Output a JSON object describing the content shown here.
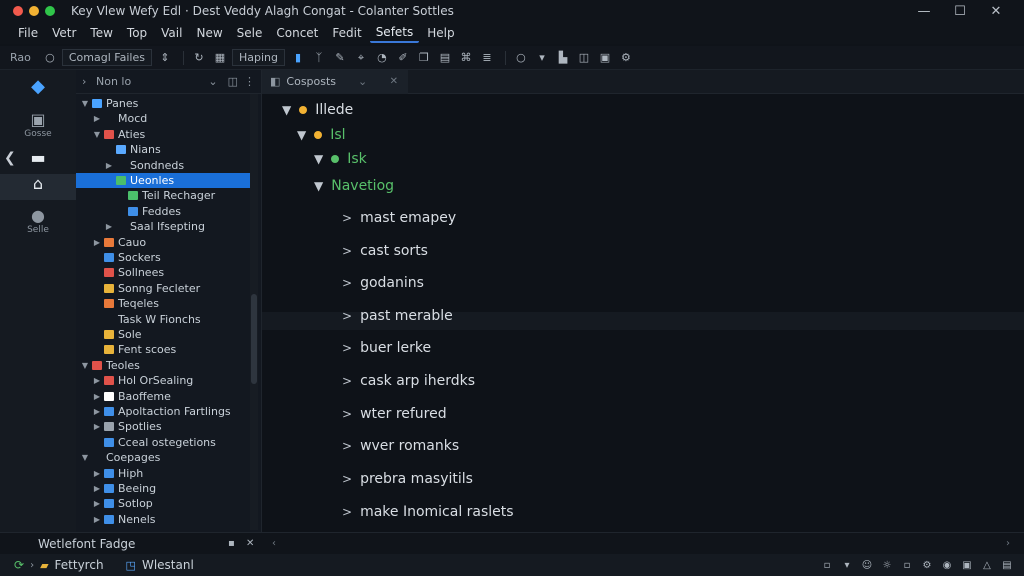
{
  "titlebar": {
    "title": "Key  Vlew  Wefy  Edl  ·  Dest  Veddy  Alagh  Congat  -  Colanter Sottles",
    "light_colors": [
      "#f25a4d",
      "#f2b233",
      "#30c54a"
    ],
    "minimize": "—",
    "maximize": "☐",
    "close": "✕"
  },
  "menubar": {
    "items": [
      "File",
      "Vetr",
      "Tew",
      "Top",
      "Vail",
      "New",
      "Sele",
      "Concet",
      "Fedit",
      "Sefets",
      "Help"
    ],
    "active_index": 9
  },
  "toolbar": {
    "left_text": "Rao",
    "combo1": "Comagl Failes",
    "combo2": "Haping"
  },
  "activity": {
    "items": [
      {
        "icon": "blocks-icon",
        "label": ""
      },
      {
        "icon": "book-icon",
        "label": "Gosse"
      },
      {
        "icon": "monitor-icon",
        "label": ""
      },
      {
        "icon": "home-icon",
        "label": ""
      },
      {
        "icon": "user-icon",
        "label": "Selle"
      }
    ]
  },
  "explorer": {
    "header": "Non lo",
    "rows": [
      {
        "label": "Panes",
        "depth": 0,
        "twisty": "▼",
        "icon": "#4aa3ff"
      },
      {
        "label": "Mocd",
        "depth": 1,
        "twisty": "▶",
        "icon": ""
      },
      {
        "label": "Aties",
        "depth": 1,
        "twisty": "▼",
        "icon": "#e0524a"
      },
      {
        "label": "Nians",
        "depth": 2,
        "twisty": "",
        "icon": "#5aa9ff"
      },
      {
        "label": "Sondneds",
        "depth": 2,
        "twisty": "▶",
        "icon": ""
      },
      {
        "label": "Ueonles",
        "depth": 2,
        "twisty": "",
        "icon": "#4bbf6b",
        "selected": true
      },
      {
        "label": "Teil Rechager",
        "depth": 3,
        "twisty": "",
        "icon": "#4bbf6b"
      },
      {
        "label": "Feddes",
        "depth": 3,
        "twisty": "",
        "icon": "#3f8fe8"
      },
      {
        "label": "Saal Ifsepting",
        "depth": 2,
        "twisty": "▶",
        "icon": ""
      },
      {
        "label": "Cauo",
        "depth": 1,
        "twisty": "▶",
        "icon": "#e8793a"
      },
      {
        "label": "Sockers",
        "depth": 1,
        "twisty": "",
        "icon": "#3f8fe8"
      },
      {
        "label": "Sollnees",
        "depth": 1,
        "twisty": "",
        "icon": "#e0524a"
      },
      {
        "label": "Sonng Fecleter",
        "depth": 1,
        "twisty": "",
        "icon": "#e8b33a"
      },
      {
        "label": "Teqeles",
        "depth": 1,
        "twisty": "",
        "icon": "#e8793a"
      },
      {
        "label": "Task W Fionchs",
        "depth": 1,
        "twisty": "",
        "icon": ""
      },
      {
        "label": "Sole",
        "depth": 1,
        "twisty": "",
        "icon": "#e8b33a"
      },
      {
        "label": "Fent scoes",
        "depth": 1,
        "twisty": "",
        "icon": "#e8b33a"
      },
      {
        "label": "Teoles",
        "depth": 0,
        "twisty": "▼",
        "icon": "#e0524a"
      },
      {
        "label": "Hol OrSealing",
        "depth": 1,
        "twisty": "▶",
        "icon": "#e0524a"
      },
      {
        "label": "Baoffeme",
        "depth": 1,
        "twisty": "▶",
        "icon": "#ffffff"
      },
      {
        "label": "Apoltaction Fartlings",
        "depth": 1,
        "twisty": "▶",
        "icon": "#3f8fe8"
      },
      {
        "label": "Spotlies",
        "depth": 1,
        "twisty": "▶",
        "icon": "#9aa3ad"
      },
      {
        "label": "Cceal ostegetions",
        "depth": 1,
        "twisty": "",
        "icon": "#3f8fe8"
      },
      {
        "label": "Coepages",
        "depth": 0,
        "twisty": "▼",
        "icon": ""
      },
      {
        "label": "Hiph",
        "depth": 1,
        "twisty": "▶",
        "icon": "#3f8fe8"
      },
      {
        "label": "Beeing",
        "depth": 1,
        "twisty": "▶",
        "icon": "#3f8fe8"
      },
      {
        "label": "Sotlop",
        "depth": 1,
        "twisty": "▶",
        "icon": "#3f8fe8"
      },
      {
        "label": "Nenels",
        "depth": 1,
        "twisty": "▶",
        "icon": "#3f8fe8"
      }
    ]
  },
  "editor": {
    "tab_label": "Cosposts",
    "lines": [
      {
        "text": "Illede",
        "indent": 0,
        "chev": "▼",
        "dot": "#f2b233",
        "green": false
      },
      {
        "text": "Isl",
        "indent": 1,
        "chev": "▼",
        "dot": "#f2b233",
        "green": true
      },
      {
        "text": "Isk",
        "indent": 2,
        "chev": "▼",
        "dot": "#58c06a",
        "green": true
      },
      {
        "text": "Navetiog",
        "indent": 2,
        "chev": "▼",
        "dot": "",
        "green": true
      },
      {
        "text": "mast emapey",
        "indent": 3,
        "chev": ">",
        "dot": "",
        "green": false
      },
      {
        "text": "cast sorts",
        "indent": 3,
        "chev": ">",
        "dot": "",
        "green": false
      },
      {
        "text": "godanins",
        "indent": 3,
        "chev": ">",
        "dot": "",
        "green": false
      },
      {
        "text": "past merable",
        "indent": 3,
        "chev": ">",
        "dot": "",
        "green": false
      },
      {
        "text": "buer lerke",
        "indent": 3,
        "chev": ">",
        "dot": "",
        "green": false
      },
      {
        "text": "cask arp iherdks",
        "indent": 3,
        "chev": ">",
        "dot": "",
        "green": false
      },
      {
        "text": "wter refured",
        "indent": 3,
        "chev": ">",
        "dot": "",
        "green": false
      },
      {
        "text": "wver romanks",
        "indent": 3,
        "chev": ">",
        "dot": "",
        "green": false
      },
      {
        "text": "prebra masyitils",
        "indent": 3,
        "chev": ">",
        "dot": "",
        "green": false
      },
      {
        "text": "make Inomical raslets",
        "indent": 3,
        "chev": ">",
        "dot": "",
        "green": false
      }
    ]
  },
  "panel": {
    "title": "Wetlefont Fadge"
  },
  "statusbar": {
    "item1": "Fettyrch",
    "item2": "Wlestanl"
  }
}
